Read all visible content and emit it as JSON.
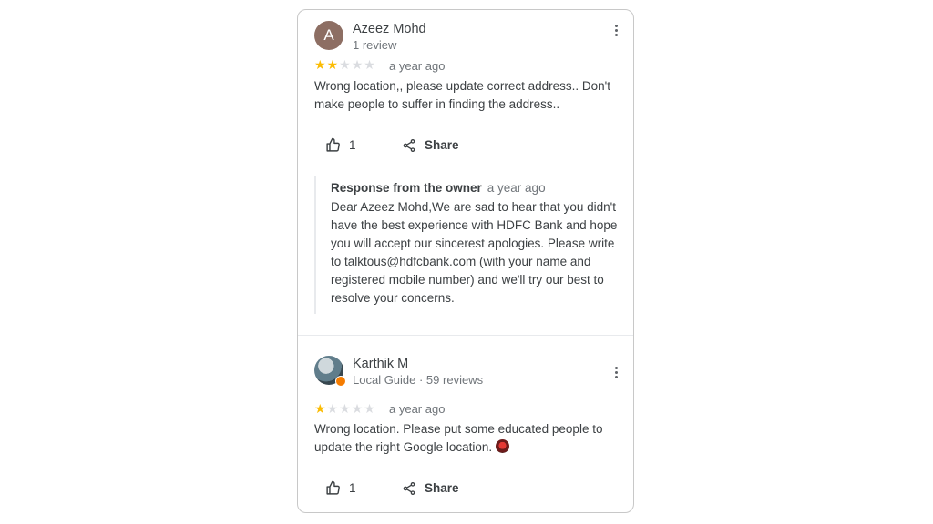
{
  "reviews": [
    {
      "avatar_letter": "A",
      "author": "Azeez Mohd",
      "meta": "1 review",
      "rating": 2,
      "rating_max": 5,
      "time": "a year ago",
      "text": "Wrong location,, please update correct address.. Don't make people to suffer in finding the address..",
      "likes": "1",
      "share_label": "Share",
      "owner_response": {
        "title": "Response from the owner",
        "time": "a year ago",
        "text": "Dear Azeez Mohd,We are sad to hear that you didn't have the best experience with HDFC Bank and hope you will accept our sincerest apologies. Please write to talktous@hdfcbank.com (with your name and registered mobile number) and we'll try our best to resolve your concerns."
      }
    },
    {
      "author": "Karthik M",
      "meta": "Local Guide · 59 reviews",
      "rating": 1,
      "rating_max": 5,
      "time": "a year ago",
      "text": "Wrong location. Please put some educated people to update the right Google location.",
      "likes": "1",
      "share_label": "Share"
    }
  ],
  "colors": {
    "star_filled": "#fbbc04",
    "star_empty": "#dadce0",
    "avatar_bg": "#8d6e63",
    "local_guide_badge": "#f57c00"
  },
  "icons": {
    "more": "more-vertical-icon",
    "like": "thumbs-up-icon",
    "share": "share-icon"
  }
}
